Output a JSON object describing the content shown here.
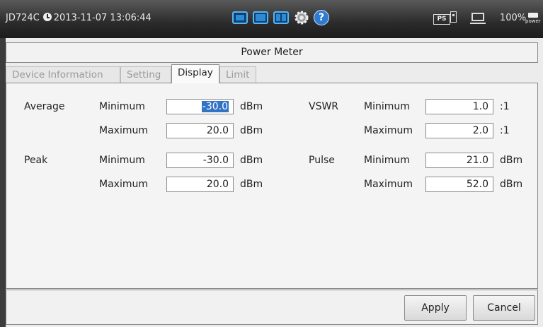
{
  "status": {
    "model": "JD724C",
    "datetime": "2013-11-07 13:06:44",
    "battery": "100%",
    "ps_label": "PS",
    "power_label": "power"
  },
  "icons": [
    "clock-icon",
    "layout-single-icon",
    "layout-split-horizontal-icon",
    "layout-split-vertical-icon",
    "gear-icon",
    "help-icon",
    "ps-icon",
    "usb-icon",
    "monitor-icon",
    "power-plug-icon"
  ],
  "colors": {
    "accent": "#2d8bd6",
    "selection": "#3373c5"
  },
  "panel": {
    "title": "Power Meter"
  },
  "tabs": [
    {
      "label": "Device Information",
      "active": false
    },
    {
      "label": "Setting",
      "active": false
    },
    {
      "label": "Display",
      "active": true
    },
    {
      "label": "Limit",
      "active": false
    }
  ],
  "display": {
    "average": {
      "label": "Average",
      "min_label": "Minimum",
      "min_value": "-30.0",
      "max_label": "Maximum",
      "max_value": "20.0",
      "unit": "dBm"
    },
    "peak": {
      "label": "Peak",
      "min_label": "Minimum",
      "min_value": "-30.0",
      "max_label": "Maximum",
      "max_value": "20.0",
      "unit": "dBm"
    },
    "vswr": {
      "label": "VSWR",
      "min_label": "Minimum",
      "min_value": "1.0",
      "max_label": "Maximum",
      "max_value": "2.0",
      "unit": ":1"
    },
    "pulse": {
      "label": "Pulse",
      "min_label": "Minimum",
      "min_value": "21.0",
      "max_label": "Maximum",
      "max_value": "52.0",
      "unit": "dBm"
    }
  },
  "buttons": {
    "apply": "Apply",
    "cancel": "Cancel"
  }
}
